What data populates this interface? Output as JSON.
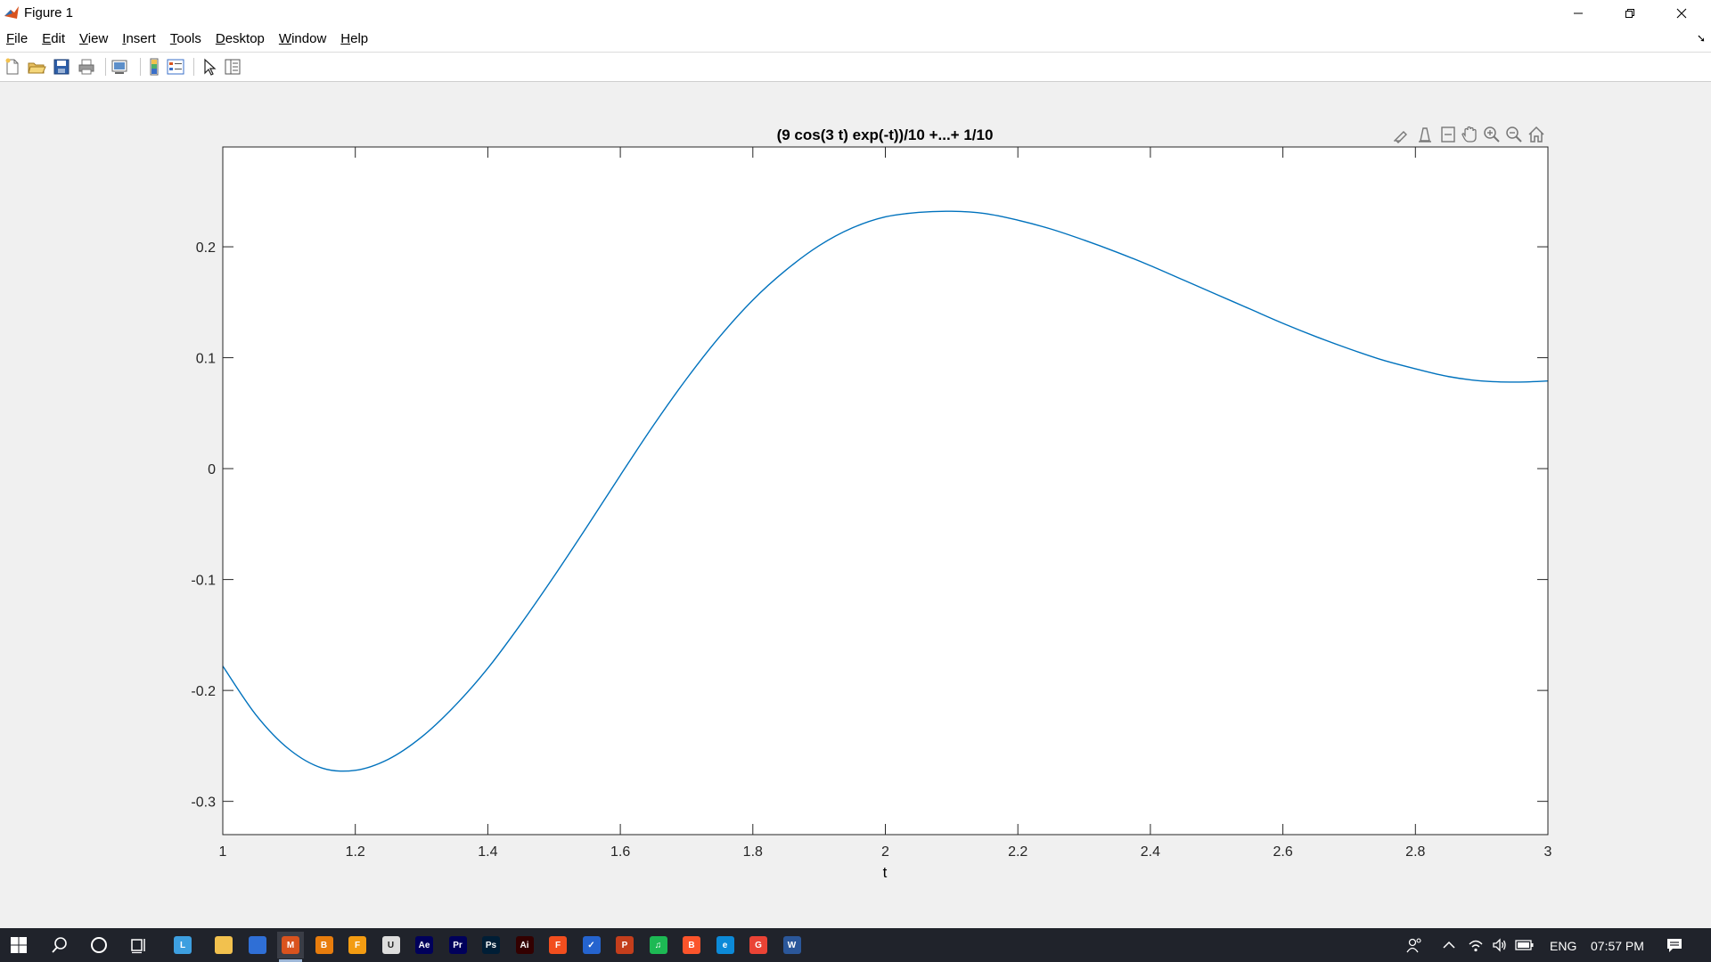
{
  "window": {
    "title": "Figure 1"
  },
  "menu": [
    {
      "label": "File",
      "key": "F",
      "rest": "ile"
    },
    {
      "label": "Edit",
      "key": "E",
      "rest": "dit"
    },
    {
      "label": "View",
      "key": "V",
      "rest": "iew"
    },
    {
      "label": "Insert",
      "key": "I",
      "rest": "nsert"
    },
    {
      "label": "Tools",
      "key": "T",
      "rest": "ools"
    },
    {
      "label": "Desktop",
      "key": "D",
      "rest": "esktop"
    },
    {
      "label": "Window",
      "key": "W",
      "rest": "indow"
    },
    {
      "label": "Help",
      "key": "H",
      "rest": "elp"
    }
  ],
  "toolbar": [
    "new-figure-icon",
    "open-file-icon",
    "save-icon",
    "print-icon",
    "link-plot-icon",
    "insert-colorbar-icon",
    "insert-legend-icon",
    "edit-plot-icon",
    "property-inspector-icon"
  ],
  "axes_toolbar": [
    "brush-icon",
    "data-tips-icon",
    "restore-view-icon",
    "pan-icon",
    "zoom-in-icon",
    "zoom-out-icon",
    "home-icon"
  ],
  "chart_data": {
    "type": "line",
    "title": "(9 cos(3 t) exp(-t))/10 +...+ 1/10",
    "xlabel": "t",
    "ylabel": "",
    "xlim": [
      1,
      3
    ],
    "ylim": [
      -0.33,
      0.29
    ],
    "xticks": [
      1,
      1.2,
      1.4,
      1.6,
      1.8,
      2,
      2.2,
      2.4,
      2.6,
      2.8,
      3
    ],
    "xtick_labels": [
      "1",
      "1.2",
      "1.4",
      "1.6",
      "1.8",
      "2",
      "2.2",
      "2.4",
      "2.6",
      "2.8",
      "3"
    ],
    "yticks": [
      -0.3,
      -0.2,
      -0.1,
      0,
      0.1,
      0.2
    ],
    "ytick_labels": [
      "-0.3",
      "-0.2",
      "-0.1",
      "0",
      "0.1",
      "0.2"
    ],
    "grid": false,
    "line_color": "#0072bd",
    "series": [
      {
        "x": [
          1,
          1.05,
          1.1,
          1.15,
          1.2,
          1.25,
          1.3,
          1.35,
          1.4,
          1.45,
          1.5,
          1.55,
          1.6,
          1.65,
          1.7,
          1.75,
          1.8,
          1.85,
          1.9,
          1.95,
          2,
          2.05,
          2.1,
          2.15,
          2.2,
          2.25,
          2.3,
          2.35,
          2.4,
          2.45,
          2.5,
          2.55,
          2.6,
          2.65,
          2.7,
          2.75,
          2.8,
          2.85,
          2.9,
          2.95,
          3
        ],
        "y": [
          -0.178,
          -0.222,
          -0.253,
          -0.27,
          -0.272,
          -0.262,
          -0.242,
          -0.214,
          -0.18,
          -0.14,
          -0.097,
          -0.052,
          -0.006,
          0.039,
          0.081,
          0.119,
          0.152,
          0.179,
          0.201,
          0.217,
          0.227,
          0.231,
          0.232,
          0.23,
          0.224,
          0.216,
          0.206,
          0.195,
          0.183,
          0.17,
          0.157,
          0.144,
          0.131,
          0.119,
          0.108,
          0.098,
          0.09,
          0.083,
          0.079,
          0.078,
          0.079
        ]
      }
    ]
  },
  "taskbar": {
    "apps": [
      {
        "name": "file-explorer-taskbar-icon",
        "color": "#f2c14e",
        "text": ""
      },
      {
        "name": "store-taskbar-icon",
        "color": "#2f6fd6",
        "text": ""
      },
      {
        "name": "matlab-taskbar-icon",
        "color": "#d9531e",
        "text": "M"
      },
      {
        "name": "blender-taskbar-icon",
        "color": "#e87d0d",
        "text": "B"
      },
      {
        "name": "fl-studio-taskbar-icon",
        "color": "#f39c12",
        "text": "F"
      },
      {
        "name": "unity-taskbar-icon",
        "color": "#dddddd",
        "text": "U"
      },
      {
        "name": "after-effects-taskbar-icon",
        "color": "#00005b",
        "text": "Ae"
      },
      {
        "name": "premiere-taskbar-icon",
        "color": "#00005b",
        "text": "Pr"
      },
      {
        "name": "photoshop-taskbar-icon",
        "color": "#001e36",
        "text": "Ps"
      },
      {
        "name": "illustrator-taskbar-icon",
        "color": "#330000",
        "text": "Ai"
      },
      {
        "name": "figma-taskbar-icon",
        "color": "#f24e1e",
        "text": "F"
      },
      {
        "name": "todo-taskbar-icon",
        "color": "#2564cf",
        "text": "✓"
      },
      {
        "name": "powerpoint-taskbar-icon",
        "color": "#c43e1c",
        "text": "P"
      },
      {
        "name": "spotify-taskbar-icon",
        "color": "#1db954",
        "text": "♫"
      },
      {
        "name": "brave-taskbar-icon",
        "color": "#fb542b",
        "text": "B"
      },
      {
        "name": "edge-taskbar-icon",
        "color": "#0c8ad8",
        "text": "e"
      },
      {
        "name": "chrome-taskbar-icon",
        "color": "#ea4335",
        "text": "G"
      },
      {
        "name": "word-taskbar-icon",
        "color": "#2b579a",
        "text": "W"
      }
    ],
    "language": "ENG",
    "time": "07:57 PM"
  }
}
